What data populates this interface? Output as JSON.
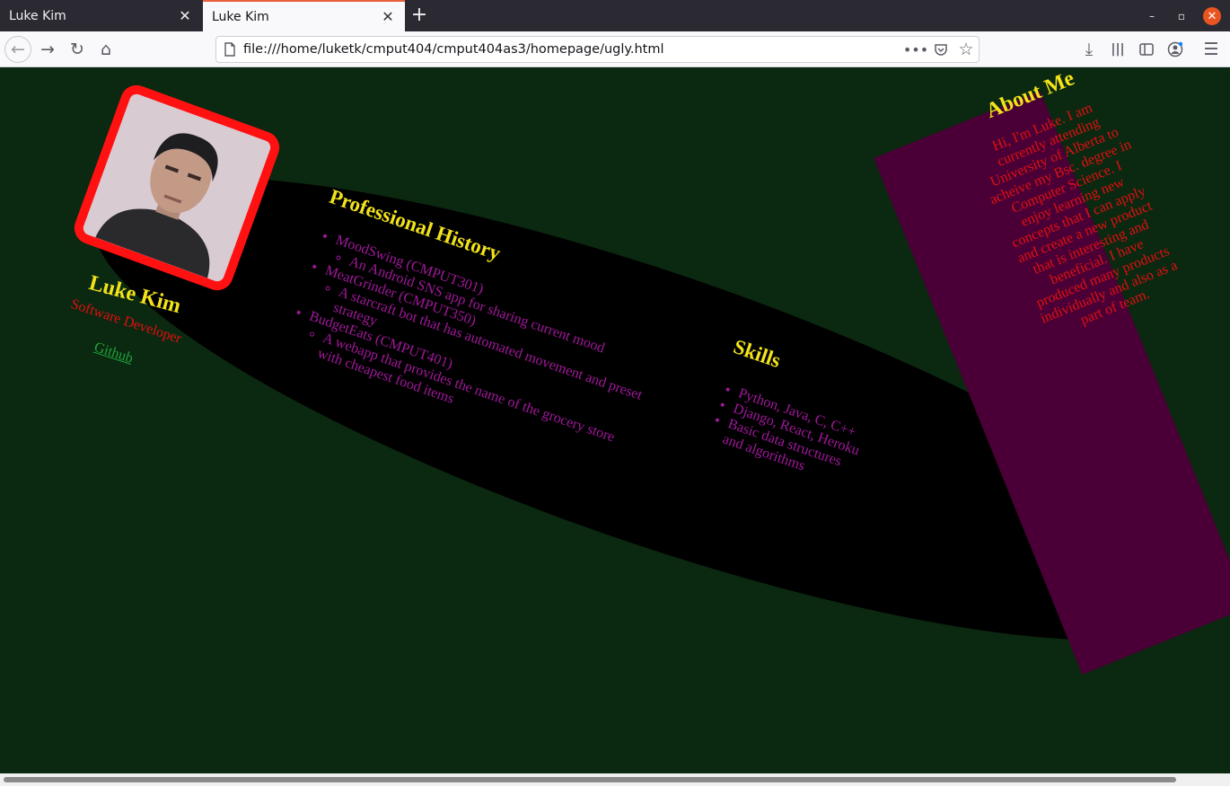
{
  "browser": {
    "tabs": [
      {
        "label": "Luke Kim",
        "active": false
      },
      {
        "label": "Luke Kim",
        "active": true
      }
    ],
    "new_tab": "+",
    "url": "file:///home/luketk/cmput404/cmput404as3/homepage/ugly.html",
    "window_controls": {
      "minimize": "–",
      "restore": "▫",
      "close": "✕"
    },
    "icons": {
      "back": "←",
      "forward": "→",
      "reload": "↻",
      "home": "⌂",
      "more": "•••",
      "pocket": "pocket-icon",
      "bookmark": "☆",
      "downloads": "⤓",
      "library": "|||",
      "sidebar": "sidebar-icon",
      "account": "account-icon",
      "menu": "☰"
    }
  },
  "profile": {
    "name": "Luke Kim",
    "role": "Software Developer",
    "github_label": "Github"
  },
  "history": {
    "title": "Professional History",
    "items": [
      {
        "name": "MoodSwing (CMPUT301)",
        "detail": "An Android SNS app for sharing current mood"
      },
      {
        "name": "MeatGrinder (CMPUT350)",
        "detail": "A starcraft bot that has automated movement and preset strategy"
      },
      {
        "name": "BudgetEats (CMPUT401)",
        "detail": "A webapp that provides the name of the grocery store with cheapest food items"
      }
    ]
  },
  "skills": {
    "title": "Skills",
    "items": [
      "Python, Java, C, C++",
      "Django, React, Heroku",
      "Basic data structures and algorithms"
    ]
  },
  "about": {
    "title": "About Me",
    "text": "Hi, I'm Luke. I am currently attending University of Alberta to acheive my Bsc. degree in Computer Science. I enjoy learning new concepts that I can apply and create a new product that is interesting and beneficial. I have produced many products individually and also as a part of team."
  },
  "colors": {
    "page_bg": "#0b2810",
    "ellipse": "#000000",
    "title_yellow": "#f2e31a",
    "red_text": "#e01010",
    "purple_text": "#a0189a",
    "about_bg": "#4a0036",
    "link_green": "#1ea33b",
    "photo_border": "#ff1111"
  }
}
